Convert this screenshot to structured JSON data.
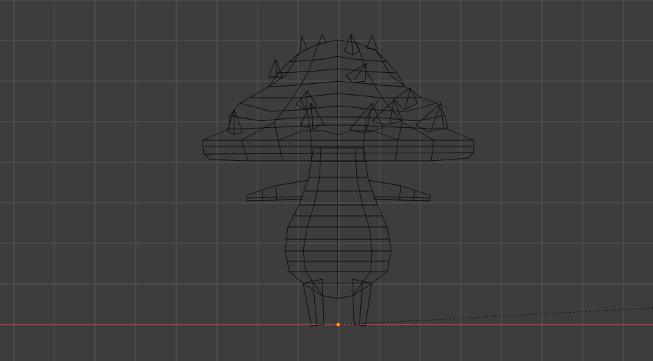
{
  "viewport": {
    "view": "front-orthographic",
    "shading": "wireframe",
    "grid": true,
    "x_axis_visible": true,
    "colors": {
      "background": "#3d3d3d",
      "grid_minor": "#4a4a4a",
      "grid_major": "#565656",
      "x_axis": "#d8434b",
      "wire": "#0d0d0d",
      "origin": "#ff9a1a",
      "relationship_line": "#1a1a1a"
    },
    "objects": [
      {
        "name": "mushroom-character",
        "type": "mesh"
      }
    ],
    "icons": [
      "origin-point-icon"
    ]
  }
}
